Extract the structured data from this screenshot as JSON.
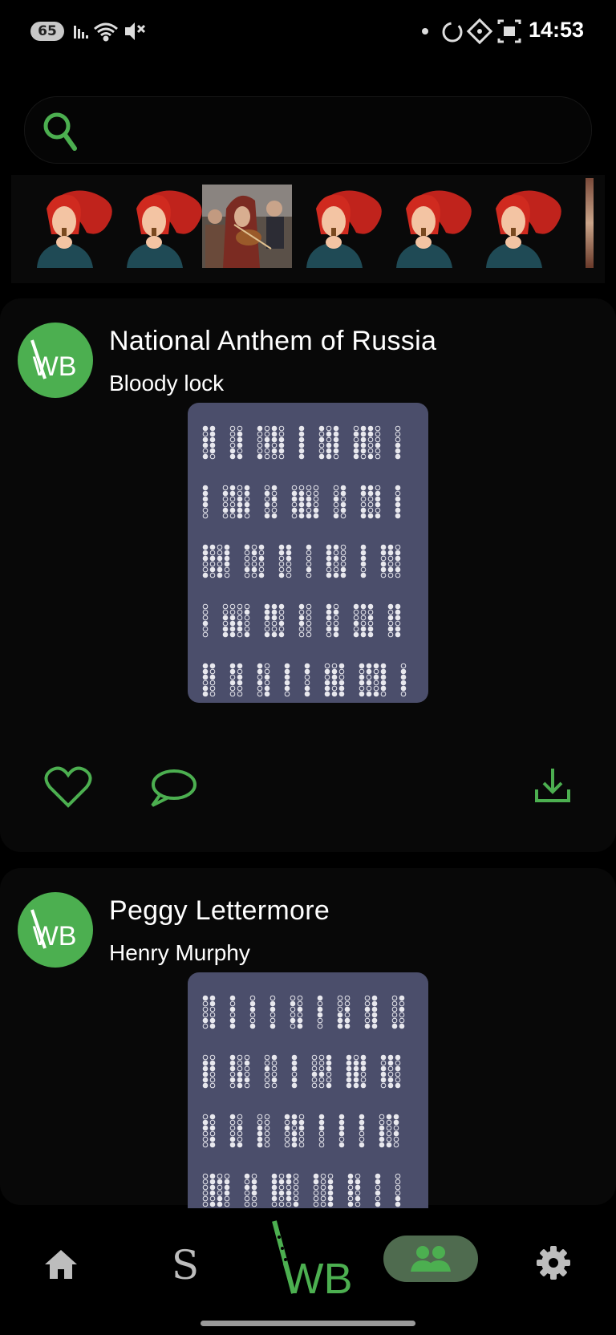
{
  "status_bar": {
    "battery": "65",
    "time": "14:53",
    "icons": [
      "signal-icon",
      "wifi-icon",
      "mute-icon",
      "dot-icon",
      "sync-icon",
      "nfc-icon",
      "screenshot-icon"
    ]
  },
  "search": {
    "placeholder": "",
    "icon": "search-icon"
  },
  "avatar_strip": {
    "items": [
      "woman-flute-avatar",
      "woman-flute-avatar",
      "violin-player-photo",
      "woman-flute-avatar",
      "woman-flute-avatar",
      "woman-flute-avatar"
    ]
  },
  "posts": [
    {
      "title": "National Anthem of Russia",
      "subtitle": "Bloody lock",
      "avatar_text": "WB"
    },
    {
      "title": "Peggy Lettermore",
      "subtitle": "Henry Murphy",
      "avatar_text": "WB"
    }
  ],
  "actions": [
    "heart-icon",
    "comment-icon",
    "download-icon"
  ],
  "bottom_nav": {
    "items": [
      "home-icon",
      "s-icon",
      "wb-logo",
      "community-icon",
      "settings-icon"
    ],
    "s_label": "S",
    "logo_text": "WB",
    "active": "community-icon"
  },
  "colors": {
    "accent": "#4caf50",
    "sheet_bg": "#4b4e6b",
    "nav_pill": "#4f6b4f",
    "background": "#000000"
  }
}
